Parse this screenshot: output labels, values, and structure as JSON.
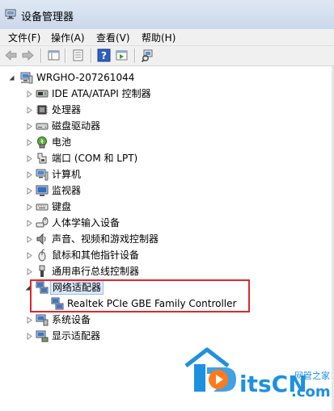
{
  "window": {
    "title": "设备管理器"
  },
  "menu": [
    "文件(F)",
    "操作(A)",
    "查看(V)",
    "帮助(H)"
  ],
  "tree": {
    "root": "WRGHO-207261044",
    "categories": [
      "IDE ATA/ATAPI 控制器",
      "处理器",
      "磁盘驱动器",
      "电池",
      "端口 (COM 和 LPT)",
      "计算机",
      "监视器",
      "键盘",
      "人体学输入设备",
      "声音、视频和游戏控制器",
      "鼠标和其他指针设备",
      "通用串行总线控制器",
      "网络适配器",
      "系统设备",
      "显示适配器"
    ],
    "network_adapter": "Realtek PCIe GBE Family Controller"
  },
  "watermark": {
    "text": "itsCN",
    "tld": ".com",
    "tagline": "网管之家"
  },
  "colors": {
    "highlight_border": "#e0262b",
    "watermark_blue": "#1e90e0"
  }
}
